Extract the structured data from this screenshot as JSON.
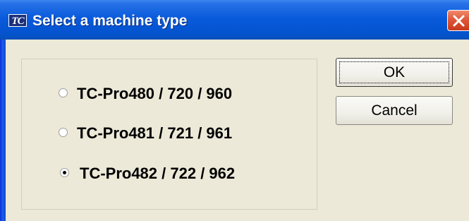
{
  "window": {
    "title": "Select a machine type",
    "icon": "TC",
    "close_icon": "close-icon"
  },
  "options": [
    {
      "label": "TC-Pro480 / 720 / 960",
      "selected": false
    },
    {
      "label": "TC-Pro481 / 721 / 961",
      "selected": false
    },
    {
      "label": "TC-Pro482 / 722 / 962",
      "selected": true
    }
  ],
  "buttons": {
    "ok_label": "OK",
    "cancel_label": "Cancel"
  },
  "colors": {
    "titlebar": "#0a5bdc",
    "client_bg": "#ece9d8",
    "close_btn": "#e0573a"
  }
}
